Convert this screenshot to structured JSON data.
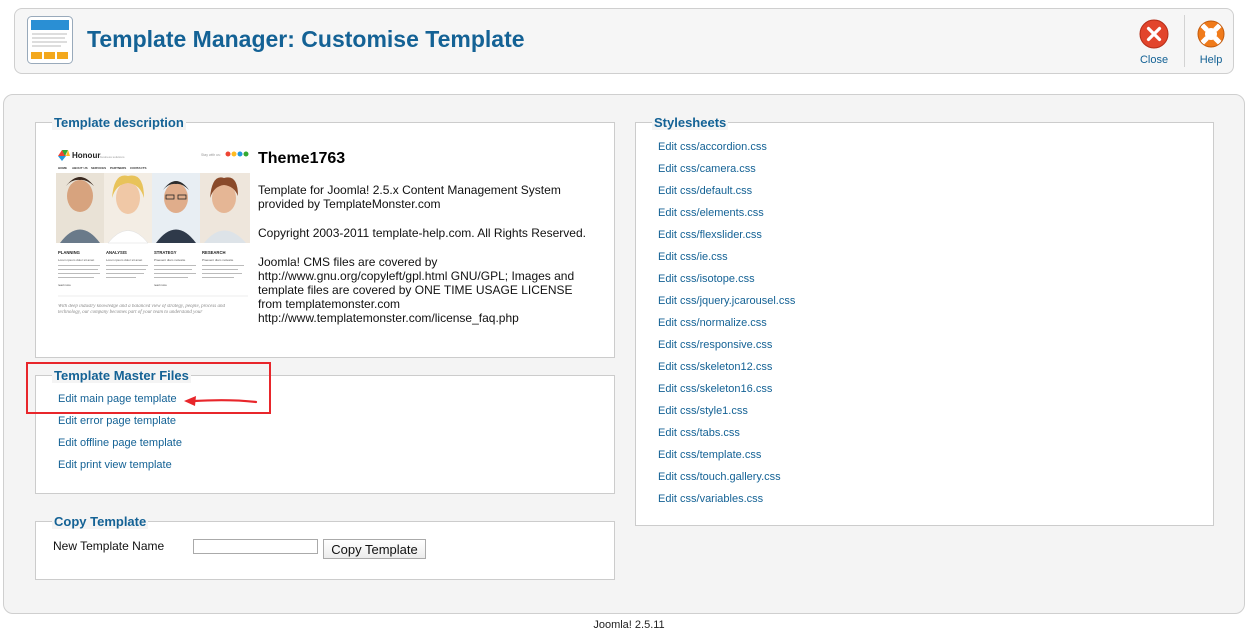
{
  "header": {
    "title": "Template Manager: Customise Template",
    "close_label": "Close",
    "help_label": "Help"
  },
  "description": {
    "legend": "Template description",
    "theme_name": "Theme1763",
    "paragraphs": [
      "Template for Joomla! 2.5.x Content Management System provided by TemplateMonster.com",
      "Copyright 2003-2011 template-help.com. All Rights Reserved.",
      "Joomla! CMS files are covered by http://www.gnu.org/copyleft/gpl.html GNU/GPL; Images and template files are covered by ONE TIME USAGE LICENSE from templatemonster.com http://www.templatemonster.com/license_faq.php"
    ],
    "preview": {
      "logo": "Honour",
      "tagline": "business solutions",
      "follow_label": "Stay with us:",
      "nav": [
        "HOME",
        "ABOUT US",
        "SERVICES",
        "PARTNERS",
        "CONTACTS"
      ],
      "columns": [
        {
          "title": "PLANNING",
          "subtitle": "Lorem ipsum dolor sit amet"
        },
        {
          "title": "ANALYSIS",
          "subtitle": "Lorem ipsum dolor sit amet"
        },
        {
          "title": "STRATEGY",
          "subtitle": "Praesent diam molestie"
        },
        {
          "title": "RESEARCH",
          "subtitle": "Praesent diam molestie"
        }
      ],
      "more_label": "read more",
      "quote": "With deep industry knowledge and a balanced view of strategy, people, process and technology, our company becomes part of your team to understand your"
    }
  },
  "master": {
    "legend": "Template Master Files",
    "links": [
      "Edit main page template",
      "Edit error page template",
      "Edit offline page template",
      "Edit print view template"
    ]
  },
  "copy": {
    "legend": "Copy Template",
    "label": "New Template Name",
    "input_value": "",
    "button_label": "Copy Template"
  },
  "stylesheets": {
    "legend": "Stylesheets",
    "links": [
      "Edit css/accordion.css",
      "Edit css/camera.css",
      "Edit css/default.css",
      "Edit css/elements.css",
      "Edit css/flexslider.css",
      "Edit css/ie.css",
      "Edit css/isotope.css",
      "Edit css/jquery.jcarousel.css",
      "Edit css/normalize.css",
      "Edit css/responsive.css",
      "Edit css/skeleton12.css",
      "Edit css/skeleton16.css",
      "Edit css/style1.css",
      "Edit css/tabs.css",
      "Edit css/template.css",
      "Edit css/touch.gallery.css",
      "Edit css/variables.css"
    ]
  },
  "footer": {
    "text": "Joomla! 2.5.11"
  },
  "colors": {
    "link": "#146295",
    "highlight": "#e8262b",
    "close": "#e2452c",
    "help": "#f07b1b"
  }
}
